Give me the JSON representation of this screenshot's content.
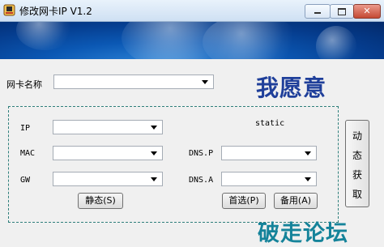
{
  "window": {
    "title": "修改网卡IP V1.2"
  },
  "adapter": {
    "label": "网卡名称",
    "value": ""
  },
  "logo_text": "我愿意",
  "fields": {
    "ip_label": "IP",
    "mac_label": "MAC",
    "gw_label": "GW",
    "dnsp_label": "DNS.P",
    "dnsa_label": "DNS.A"
  },
  "mode_status": "static",
  "buttons": {
    "static": "静态(S)",
    "primary": "首选(P)",
    "backup": "备用(A)",
    "dynamic": [
      "动",
      "态",
      "获",
      "取"
    ]
  },
  "watermark": "破走论坛"
}
